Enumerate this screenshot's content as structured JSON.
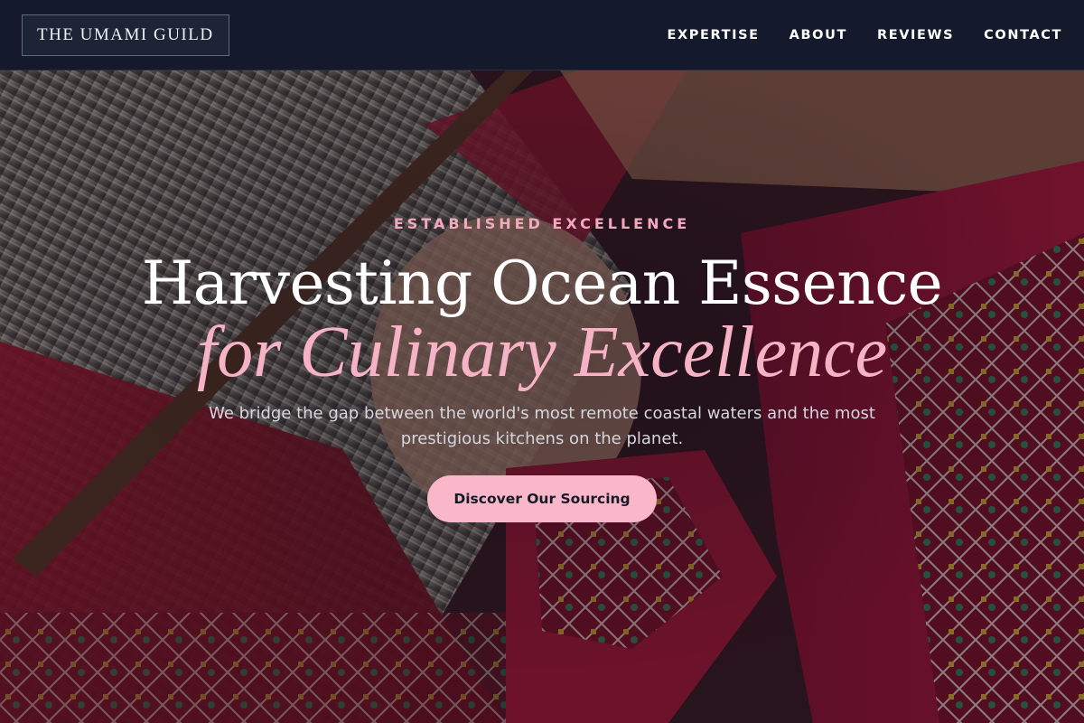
{
  "header": {
    "logo": "THE UMAMI GUILD",
    "nav": [
      {
        "label": "EXPERTISE"
      },
      {
        "label": "ABOUT"
      },
      {
        "label": "REVIEWS"
      },
      {
        "label": "CONTACT"
      }
    ]
  },
  "hero": {
    "eyebrow": "ESTABLISHED EXCELLENCE",
    "headline_line1": "Harvesting Ocean Essence",
    "headline_line2": "for Culinary Excellence",
    "subtext": "We bridge the gap between the world's most remote coastal waters and the most prestigious kitchens on the planet.",
    "cta_label": "Discover Our Sourcing"
  },
  "colors": {
    "header_bg": "#141a2b",
    "accent_pink": "#f7b3c6",
    "button_bg": "#fab7c9"
  }
}
